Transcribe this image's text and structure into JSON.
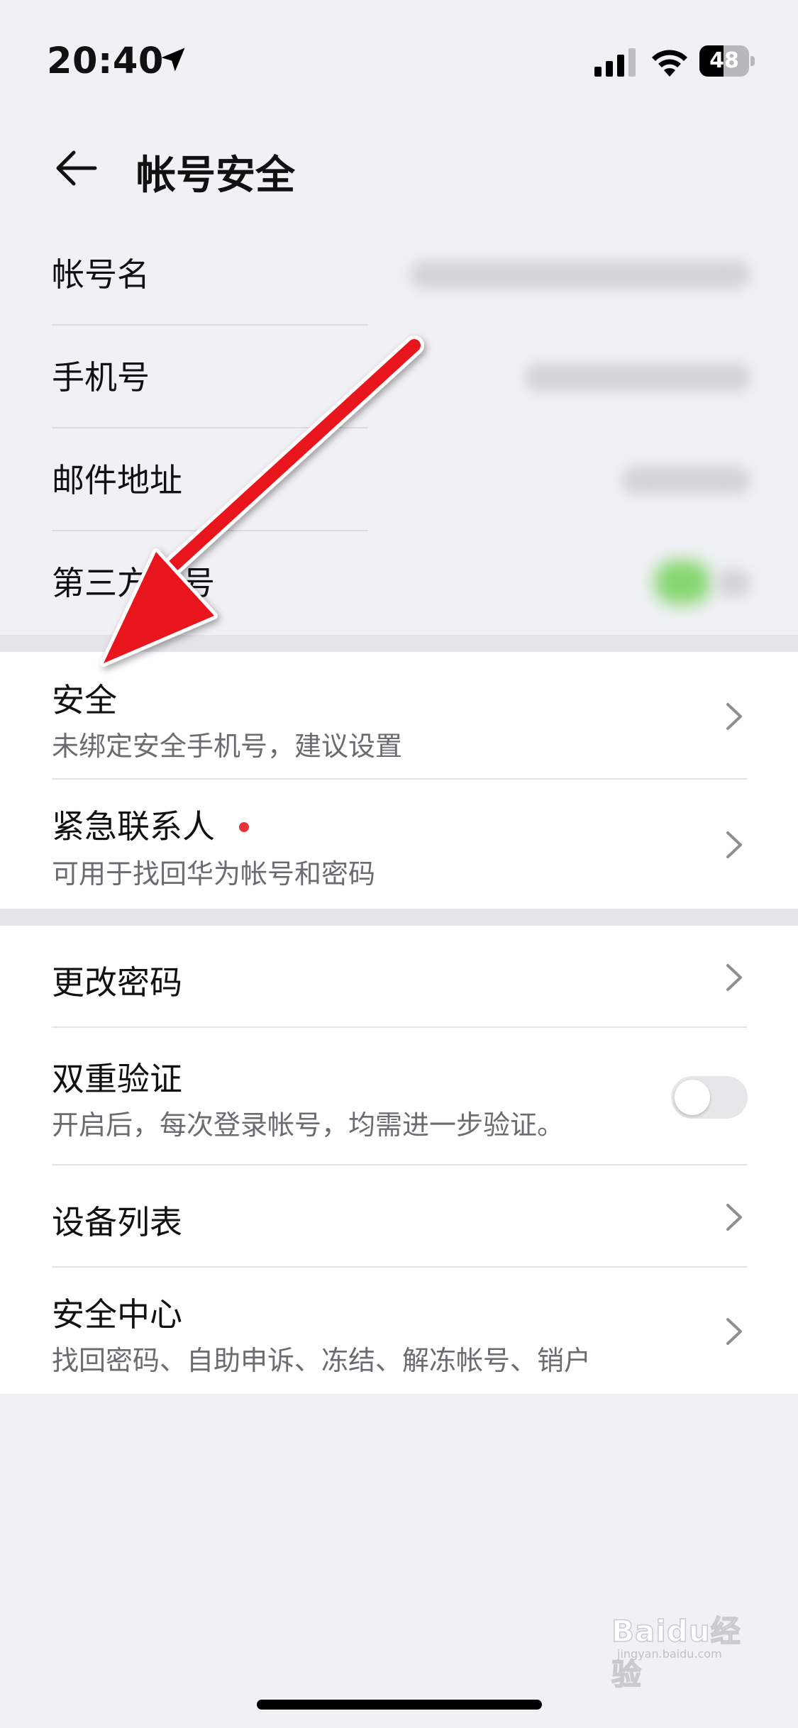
{
  "status_bar": {
    "time": "20:40",
    "battery": "48",
    "battery_level": 0.48,
    "icons": [
      "location-arrow-icon",
      "cellular-signal-icon",
      "wifi-icon",
      "battery-icon"
    ]
  },
  "nav": {
    "title": "帐号安全",
    "back_icon": "back-arrow-icon"
  },
  "account_info": [
    {
      "label": "帐号名"
    },
    {
      "label": "手机号"
    },
    {
      "label": "邮件地址"
    },
    {
      "label": "第三方帐号"
    }
  ],
  "security_section": [
    {
      "title": "安全",
      "subtitle": "未绑定安全手机号，建议设置"
    },
    {
      "title": "紧急联系人",
      "subtitle": "可用于找回华为帐号和密码",
      "badge": "red-dot"
    }
  ],
  "settings_section": [
    {
      "title": "更改密码"
    },
    {
      "title": "双重验证",
      "subtitle": "开启后，每次登录帐号，均需进一步验证。",
      "toggle_on": false
    },
    {
      "title": "设备列表"
    },
    {
      "title": "安全中心",
      "subtitle": "找回密码、自助申诉、冻结、解冻帐号、销户"
    }
  ],
  "annotation": {
    "color": "#e8141b"
  },
  "watermark": {
    "brand": "Baidu经验",
    "url": "jingyan.baidu.com"
  },
  "colors": {
    "background": "#f1f1f5",
    "card": "#ffffff",
    "subtitle": "#6b6b70",
    "toggle_off": "#e7e7ea",
    "badge": "#e6353a"
  }
}
